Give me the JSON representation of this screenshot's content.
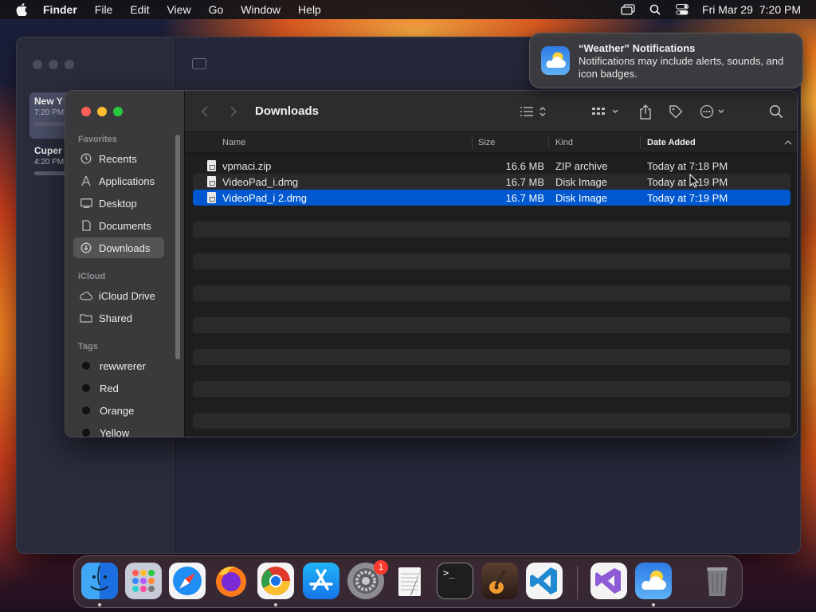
{
  "menubar": {
    "app_name": "Finder",
    "menus": [
      "File",
      "Edit",
      "View",
      "Go",
      "Window",
      "Help"
    ],
    "clock_date": "Fri Mar 29",
    "clock_time": "7:20 PM"
  },
  "notes_window": {
    "items": [
      {
        "title": "New Y",
        "time": "7:20 PM"
      },
      {
        "title": "Cuper",
        "time": "4:20 PM"
      }
    ]
  },
  "finder": {
    "title": "Downloads",
    "sidebar": {
      "favorites_header": "Favorites",
      "favorites": [
        {
          "label": "Recents",
          "icon": "clock-icon"
        },
        {
          "label": "Applications",
          "icon": "applications-icon"
        },
        {
          "label": "Desktop",
          "icon": "desktop-icon"
        },
        {
          "label": "Documents",
          "icon": "document-icon"
        },
        {
          "label": "Downloads",
          "icon": "download-icon"
        }
      ],
      "icloud_header": "iCloud",
      "icloud": [
        {
          "label": "iCloud Drive",
          "icon": "cloud-icon"
        },
        {
          "label": "Shared",
          "icon": "shared-folder-icon"
        }
      ],
      "tags_header": "Tags",
      "tags": [
        "rewwrerer",
        "Red",
        "Orange",
        "Yellow"
      ]
    },
    "columns": {
      "name": "Name",
      "size": "Size",
      "kind": "Kind",
      "date": "Date Added"
    },
    "files": [
      {
        "name": "vpmaci.zip",
        "size": "16.6 MB",
        "kind": "ZIP archive",
        "date": "Today at 7:18 PM"
      },
      {
        "name": "VideoPad_i.dmg",
        "size": "16.7 MB",
        "kind": "Disk Image",
        "date": "Today at 7:19 PM"
      },
      {
        "name": "VideoPad_i 2.dmg",
        "size": "16.7 MB",
        "kind": "Disk Image",
        "date": "Today at 7:19 PM"
      }
    ]
  },
  "notification": {
    "title": "“Weather” Notifications",
    "body": "Notifications may include alerts, sounds, and icon badges."
  },
  "dock": {
    "settings_badge": "1",
    "terminal_prompt": ">_"
  },
  "colors": {
    "selection": "#0058d0",
    "tag_dot": "#111111",
    "red_light": "#fe5f57",
    "yellow_light": "#febc2e",
    "green_light": "#28c840"
  }
}
